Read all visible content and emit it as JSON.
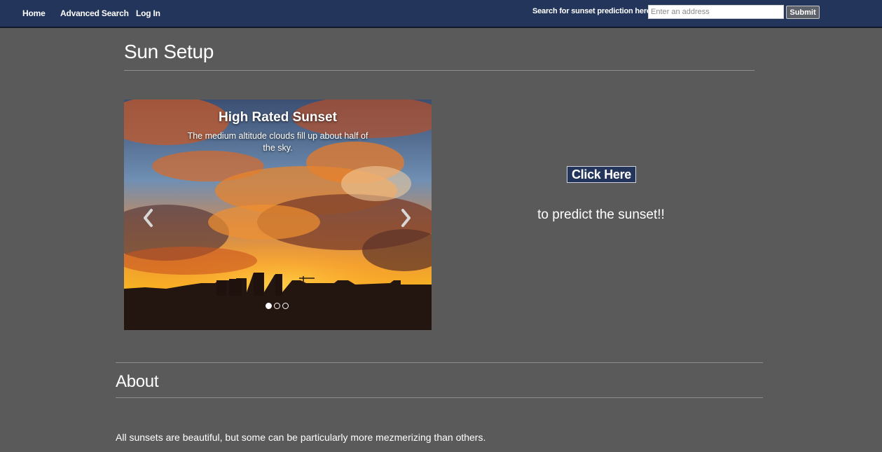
{
  "nav": {
    "home": "Home",
    "advanced_search": "Advanced Search",
    "login": "Log In",
    "search_label": "Search for sunset prediction here",
    "search_placeholder": "Enter an address",
    "submit": "Submit"
  },
  "page": {
    "title": "Sun Setup"
  },
  "carousel": {
    "caption_title": "High Rated Sunset",
    "caption_text": "The medium altitude clouds fill up about half of the sky.",
    "slide_count": 3,
    "active_slide": 1,
    "prev_icon": "chevron-left-icon",
    "next_icon": "chevron-right-icon"
  },
  "cta": {
    "button_label": "Click Here",
    "text": "to predict the sunset!!"
  },
  "about": {
    "title": "About",
    "text": "All sunsets are beautiful, but some can be particularly more mezmerizing than others."
  },
  "colors": {
    "navbar": "#23355a",
    "background": "#5a5a5a",
    "cta_button": "#23355a"
  }
}
